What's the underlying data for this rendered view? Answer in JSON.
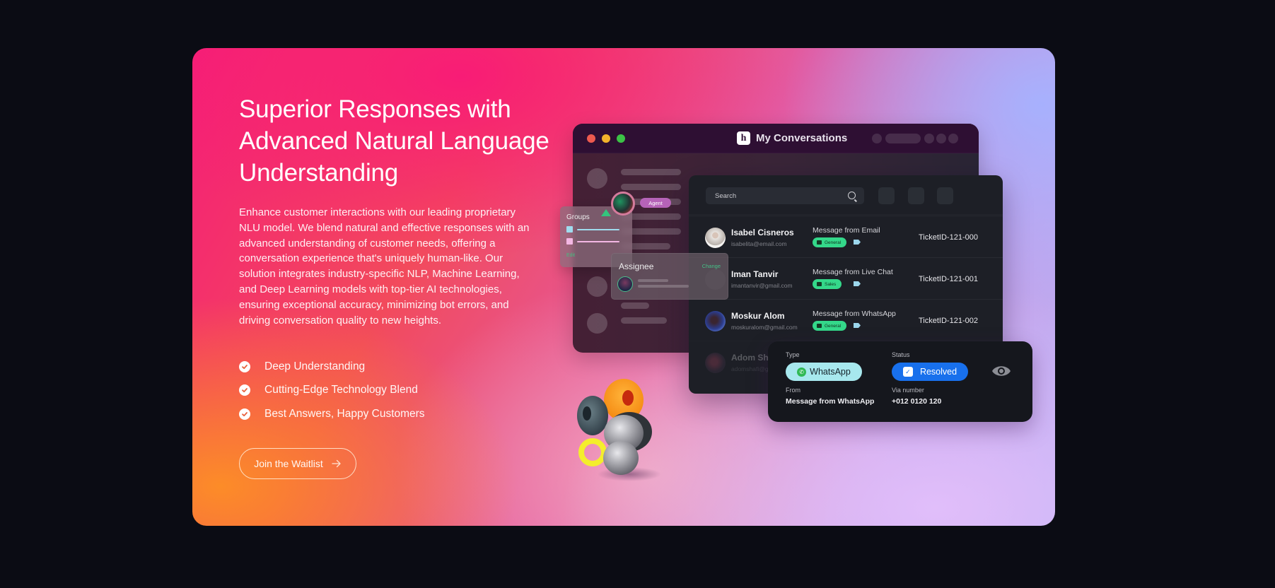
{
  "hero": {
    "title": "Superior Responses with Advanced Natural Language Understanding",
    "description": "Enhance customer interactions with our leading proprietary NLU model. We blend natural and effective responses with an advanced understanding of customer needs, offering a conversation experience that's uniquely human-like. Our solution integrates industry-specific NLP, Machine Learning, and Deep Learning models with top-tier AI technologies, ensuring exceptional accuracy, minimizing bot errors, and driving conversation quality to new heights.",
    "features": [
      {
        "icon": "check-circle-icon",
        "label": "Deep Understanding"
      },
      {
        "icon": "check-circle-icon",
        "label": "Cutting-Edge Technology Blend"
      },
      {
        "icon": "check-circle-icon",
        "label": "Best Answers, Happy Customers"
      }
    ],
    "cta": {
      "label": "Join the Waitlist",
      "icon": "arrow-right-icon"
    }
  },
  "app_window": {
    "title": "My Conversations",
    "logo_letter": "h",
    "traffic_lights": {
      "close": "#ed5a4f",
      "minimize": "#f2b32b",
      "maximize": "#3cc246"
    }
  },
  "groups_popup": {
    "label": "Groups",
    "edit_label": "Edit",
    "swatches": [
      "#9fdcee",
      "#f3b7e3"
    ]
  },
  "agent_badge": {
    "label": "Agent"
  },
  "assignee_popup": {
    "label": "Assignee",
    "change_label": "Change"
  },
  "tickets": {
    "search_placeholder": "Search",
    "rows": [
      {
        "name": "Isabel Cisneros",
        "email": "isabelita@email.com",
        "message": "Message from Email",
        "tag": "General",
        "ticket_id": "TicketID-121-000"
      },
      {
        "name": "Iman Tanvir",
        "email": "imantanvir@gmail.com",
        "message": "Message from Live Chat",
        "tag": "Sales",
        "ticket_id": "TicketID-121-001"
      },
      {
        "name": "Moskur Alom",
        "email": "moskuralom@gmail.com",
        "message": "Message from WhatsApp",
        "tag": "General",
        "ticket_id": "TicketID-121-002"
      },
      {
        "name": "Adom Shafi",
        "email": "adomshafi@gmail.com",
        "message": "",
        "tag": "",
        "ticket_id": ""
      }
    ]
  },
  "detail_card": {
    "type_label": "Type",
    "type_value": "WhatsApp",
    "status_label": "Status",
    "status_value": "Resolved",
    "from_label": "From",
    "from_value": "Message from WhatsApp",
    "via_label": "Via number",
    "via_value": "+012 0120 120",
    "colors": {
      "type_pill": "#a7e8ee",
      "status_pill": "#1870ec"
    }
  }
}
